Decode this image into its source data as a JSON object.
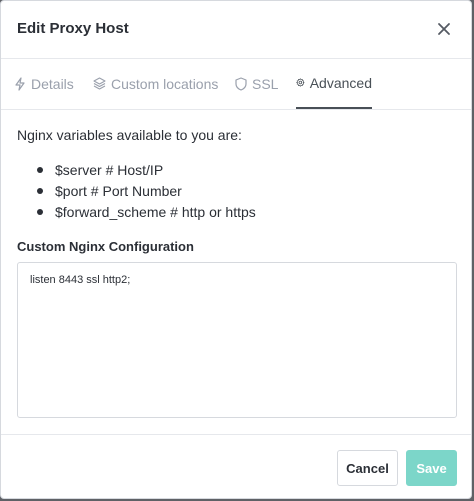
{
  "dialog": {
    "title": "Edit Proxy Host"
  },
  "tabs": [
    {
      "label": "Details",
      "icon": "bolt-icon",
      "active": false
    },
    {
      "label": "Custom locations",
      "icon": "layers-icon",
      "active": false
    },
    {
      "label": "SSL",
      "icon": "shield-icon",
      "active": false
    },
    {
      "label": "Advanced",
      "icon": "gear-icon",
      "active": true
    }
  ],
  "advanced": {
    "intro": "Nginx variables available to you are:",
    "variables": [
      "$server # Host/IP",
      "$port # Port Number",
      "$forward_scheme # http or https"
    ],
    "config_label": "Custom Nginx Configuration",
    "config_value": "listen 8443 ssl http2;"
  },
  "footer": {
    "cancel_label": "Cancel",
    "save_label": "Save"
  },
  "colors": {
    "save_button": "#7cd6c9",
    "active_tab": "#495057",
    "inactive_tab": "#9aa0ac"
  }
}
